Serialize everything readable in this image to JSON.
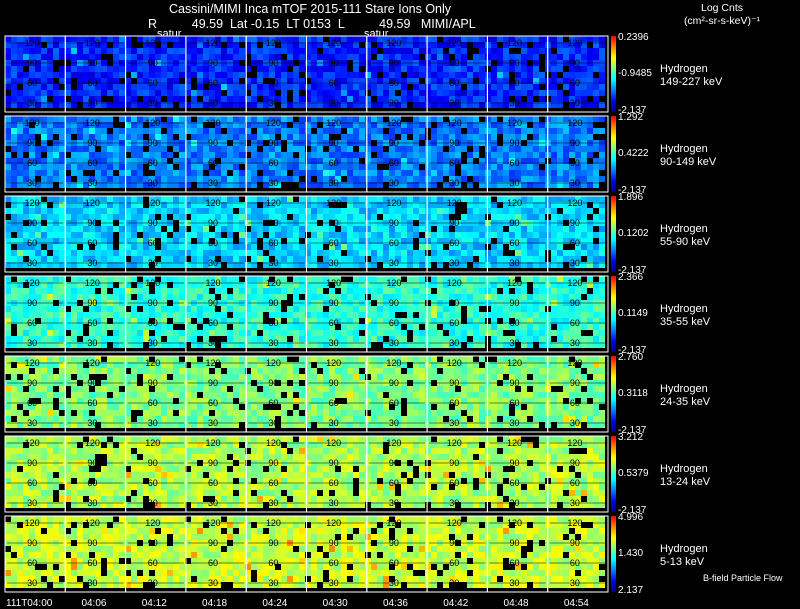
{
  "header": {
    "title": "Cassini/MIMI Inca mTOF  2015-111   Stare   Ions Only",
    "info": "R          49.59  Lat -0.15  LT 0153  L          49.59   MIMI/APL",
    "units_line1": "Log Cnts",
    "units_line2": "(cm²-sr-s-keV)⁻¹"
  },
  "frame_label": "satur",
  "footer_note": "B-field Particle Flow",
  "x_tick_labels": [
    "111T04:00",
    "04:06",
    "04:12",
    "04:18",
    "04:24",
    "04:30",
    "04:36",
    "04:42",
    "04:48",
    "04:54"
  ],
  "chart_data": {
    "type": "heatmap",
    "title": "Cassini/MIMI Inca mTOF  2015-111   Stare   Ions Only",
    "species": "Hydrogen",
    "frame_y_ticks": [
      120,
      90,
      60,
      30
    ],
    "panels": [
      {
        "species": "Hydrogen",
        "energy": "149-227 keV",
        "cb_max": "0.2396",
        "cb_mid": "-0.9485",
        "cb_min": "-2.137",
        "level": 0.18
      },
      {
        "species": "Hydrogen",
        "energy": "90-149 keV",
        "cb_max": "1.292",
        "cb_mid": "0.4222",
        "cb_min": "-2.137",
        "level": 0.28
      },
      {
        "species": "Hydrogen",
        "energy": "55-90 keV",
        "cb_max": "1.896",
        "cb_mid": "0.1202",
        "cb_min": "-2.137",
        "level": 0.38
      },
      {
        "species": "Hydrogen",
        "energy": "35-55 keV",
        "cb_max": "2.366",
        "cb_mid": "0.1149",
        "cb_min": "-2.137",
        "level": 0.47
      },
      {
        "species": "Hydrogen",
        "energy": "24-35 keV",
        "cb_max": "2.760",
        "cb_mid": "0.3118",
        "cb_min": "-2.137",
        "level": 0.57
      },
      {
        "species": "Hydrogen",
        "energy": "13-24 keV",
        "cb_max": "3.212",
        "cb_mid": "0.5379",
        "cb_min": "-2.137",
        "level": 0.62
      },
      {
        "species": "Hydrogen",
        "energy": "5-13 keV",
        "cb_max": "4.996",
        "cb_mid": "1.430",
        "cb_min": "2.137",
        "level": 0.65
      }
    ]
  },
  "colors": {
    "colorbar": [
      "#000080",
      "#0000ff",
      "#0080ff",
      "#00ffff",
      "#80ff80",
      "#ffff00",
      "#ff8000",
      "#ff0000"
    ],
    "frame_line": "#ffffff",
    "background": "#000000"
  }
}
